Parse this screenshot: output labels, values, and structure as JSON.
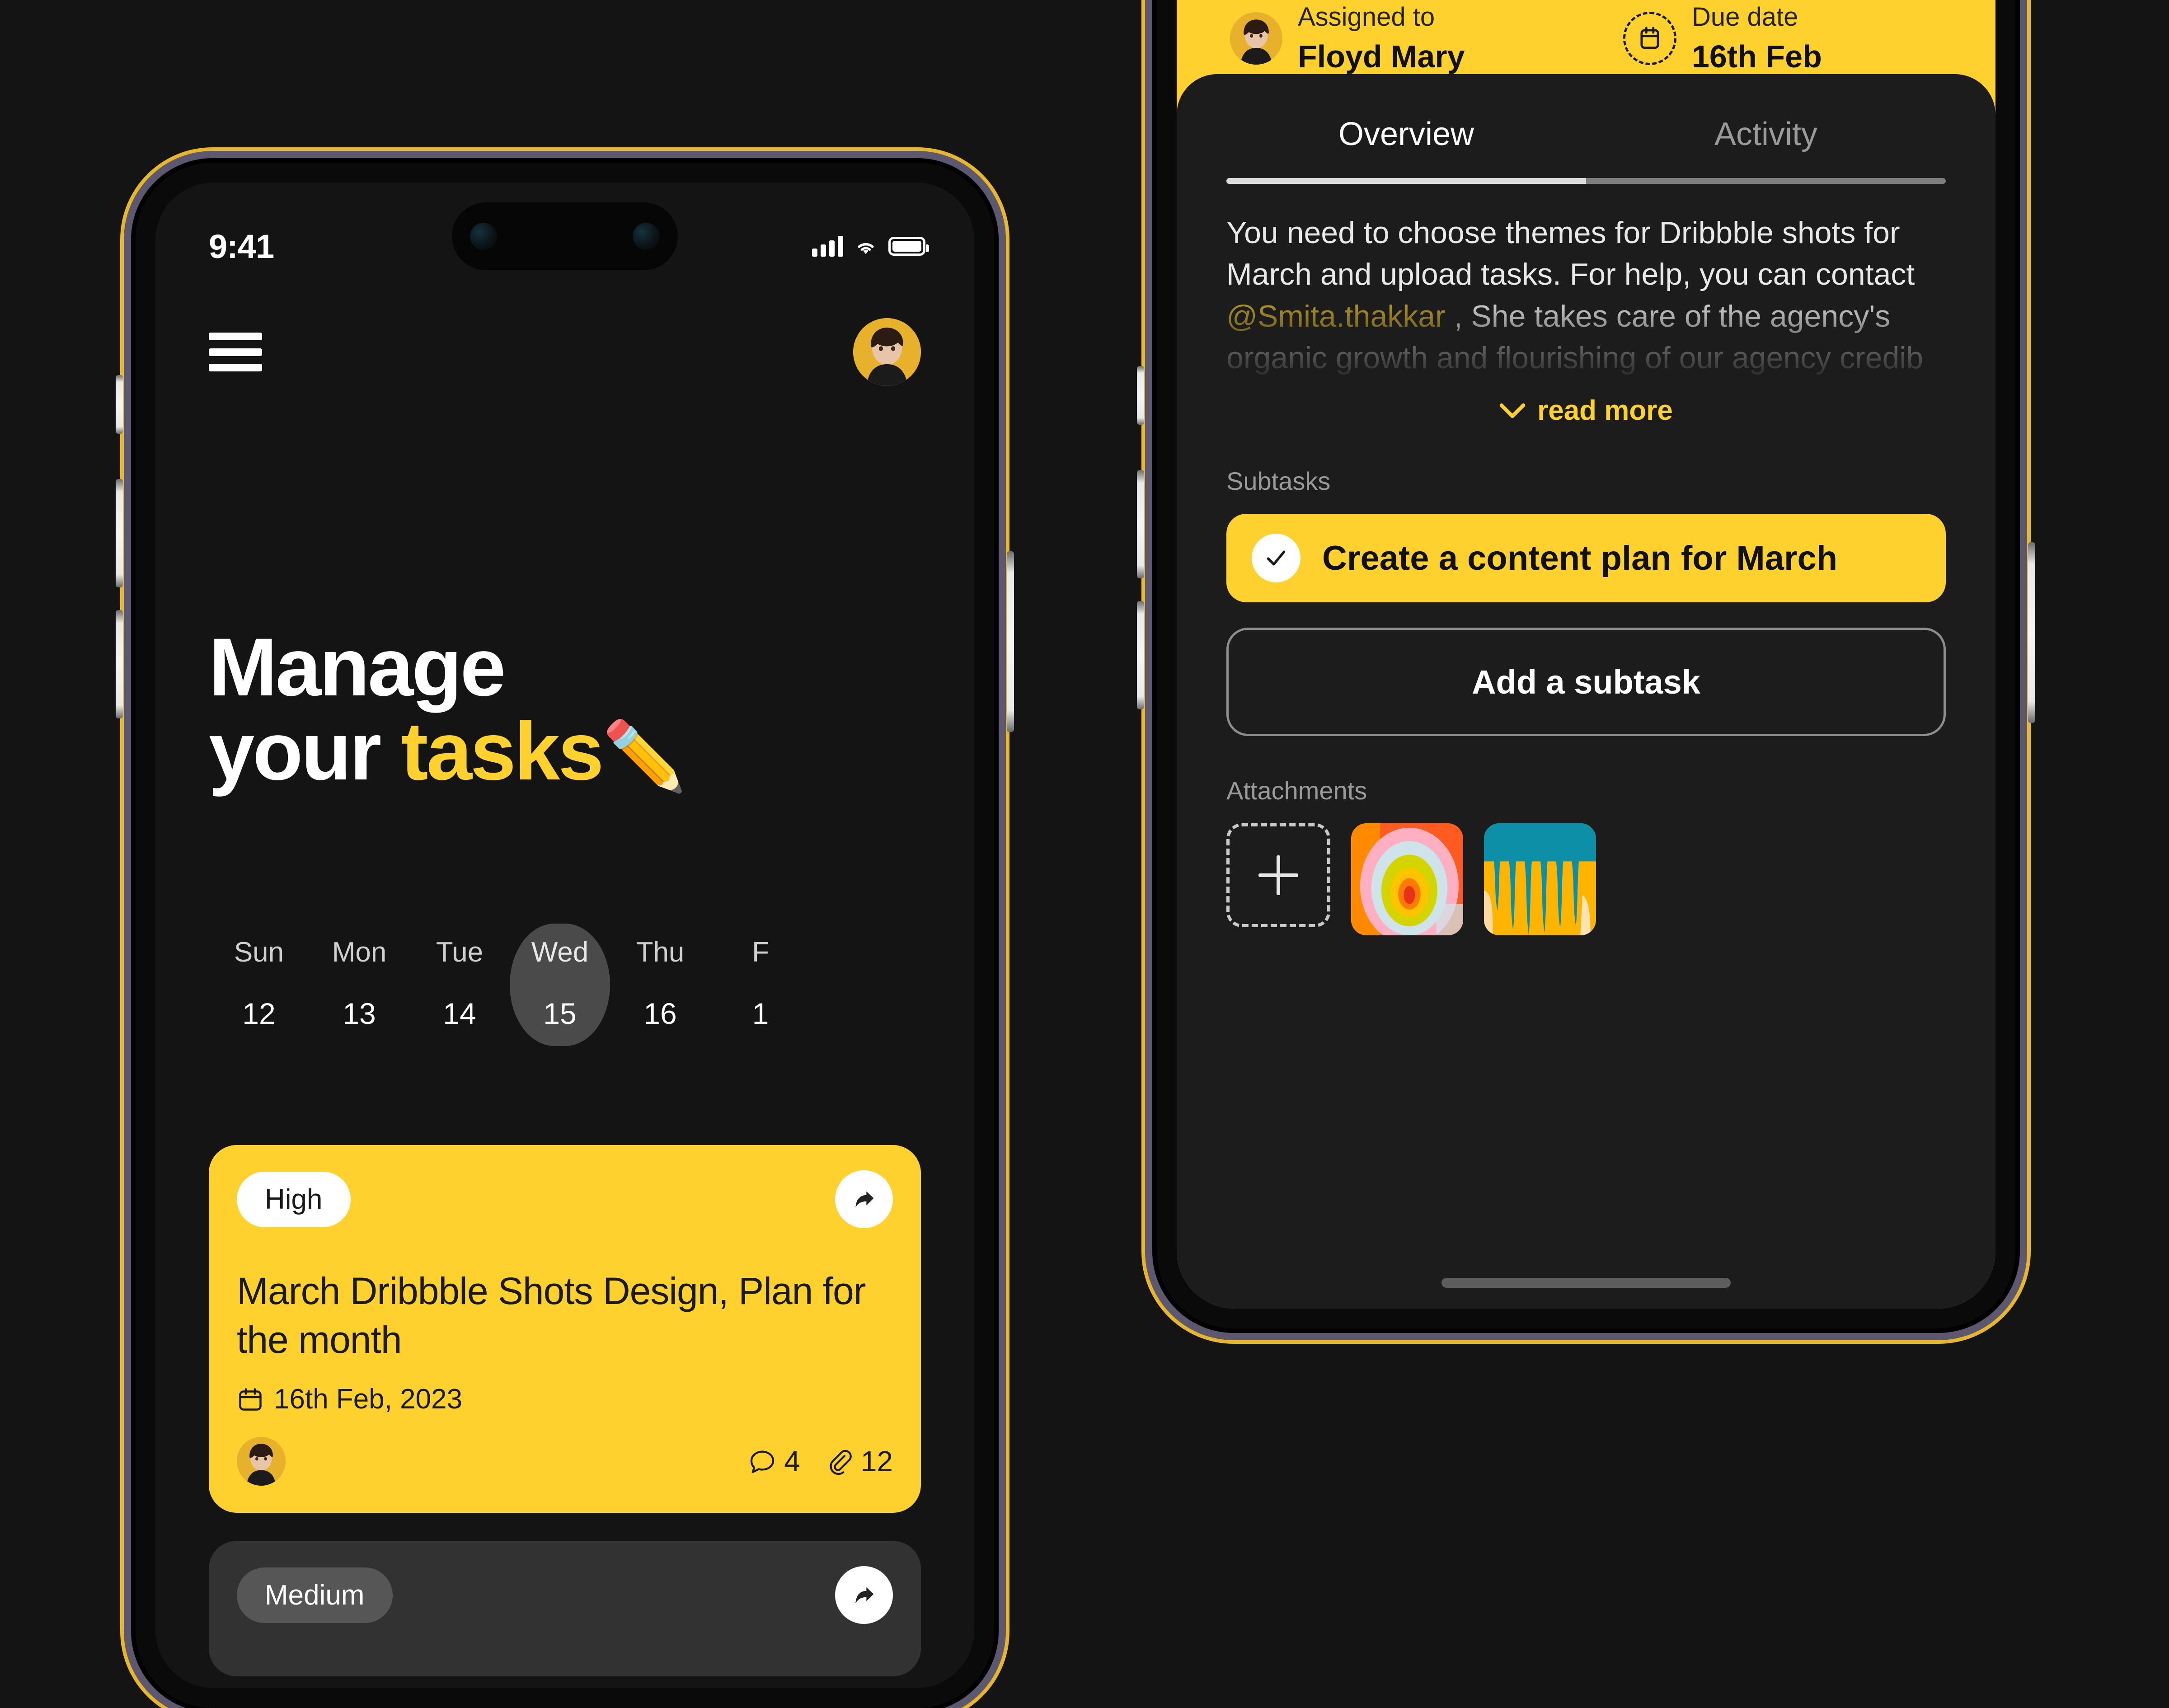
{
  "theme": {
    "accent_yellow": "#FFD12F",
    "background_dark": "#141414",
    "sheet_dark": "#1C1C1C",
    "card_grey": "#323232",
    "frame_gold": "#E8B629",
    "frame_purple": "#5D5870"
  },
  "status_bar": {
    "time": "9:41",
    "signal_icon": "cellular-signal-icon",
    "wifi_icon": "wifi-icon",
    "battery_icon": "battery-icon"
  },
  "home_screen": {
    "menu_icon": "hamburger-menu-icon",
    "avatar": "user-avatar",
    "headline_line1": "Manage",
    "headline_line2_plain": "your ",
    "headline_line2_accent": "tasks",
    "headline_emoji": "✏️",
    "week": {
      "days": [
        {
          "name": "Sun",
          "date": "12",
          "selected": false
        },
        {
          "name": "Mon",
          "date": "13",
          "selected": false
        },
        {
          "name": "Tue",
          "date": "14",
          "selected": false
        },
        {
          "name": "Wed",
          "date": "15",
          "selected": true
        },
        {
          "name": "Thu",
          "date": "16",
          "selected": false
        },
        {
          "name": "F",
          "date": "1",
          "selected": false
        }
      ]
    },
    "cards": [
      {
        "priority": "High",
        "priority_style": "light",
        "share_icon": "share-arrow-icon",
        "title": "March Dribbble Shots Design, Plan for the month",
        "calendar_icon": "calendar-icon",
        "date": "16th Feb, 2023",
        "avatar": "assignee-avatar",
        "comments_icon": "comment-bubble-icon",
        "comments": "4",
        "attachments_icon": "paperclip-icon",
        "attachments": "12"
      },
      {
        "priority": "Medium",
        "priority_style": "grey",
        "share_icon": "share-arrow-icon"
      }
    ]
  },
  "detail_screen": {
    "assigned": {
      "label": "Assigned to",
      "value": "Floyd Mary",
      "avatar": "assignee-avatar"
    },
    "due": {
      "label": "Due date",
      "value": "16th Feb",
      "icon": "calendar-dashed-circle-icon"
    },
    "tabs": [
      {
        "label": "Overview",
        "active": true
      },
      {
        "label": "Activity",
        "active": false
      }
    ],
    "description_part1": "You need to choose themes for Dribbble shots for March and upload tasks. For help, you can contact ",
    "description_mention": "@Smita.thakkar",
    "description_part2": " , She takes care of the agency's organic growth and flourishing of our agency credib",
    "read_more": "read more",
    "read_more_icon": "chevron-down-icon",
    "subtasks_label": "Subtasks",
    "subtasks": [
      {
        "label": "Create a content plan for March",
        "checked": true,
        "check_icon": "check-icon"
      }
    ],
    "add_subtask_label": "Add a subtask",
    "attachments_label": "Attachments",
    "attachments": [
      {
        "type": "add",
        "icon": "plus-icon"
      },
      {
        "type": "image",
        "name": "abstract-rings-thumbnail"
      },
      {
        "type": "image",
        "name": "abstract-drip-thumbnail"
      }
    ],
    "home_indicator": "home-indicator"
  }
}
